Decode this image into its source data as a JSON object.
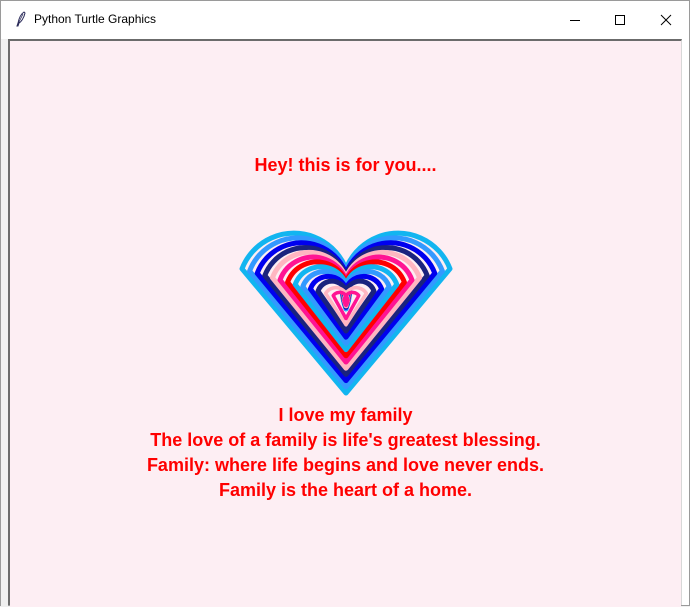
{
  "window": {
    "title": "Python Turtle Graphics",
    "minimize_icon": "minimize-icon",
    "maximize_icon": "maximize-icon",
    "close_icon": "close-icon",
    "app_icon": "feather-icon"
  },
  "canvas": {
    "background": "#fdeef3",
    "text_color": "#ff0000",
    "greeting": "Hey! this is for you....",
    "messages": [
      "I love my family",
      "The love of a family is life's greatest blessing.",
      "Family: where life begins and love never ends.",
      "Family is the heart of a home."
    ],
    "heart": {
      "icon": "nested-hearts-drawing",
      "ring_colors": [
        "#12b5f0",
        "#3399ff",
        "#0000ee",
        "#1a237e",
        "#ffb6c1",
        "#ff1493",
        "#ff0000",
        "#12b5f0",
        "#3399ff",
        "#0000ee",
        "#1a237e",
        "#ffb6c1",
        "#ff1493"
      ]
    }
  }
}
